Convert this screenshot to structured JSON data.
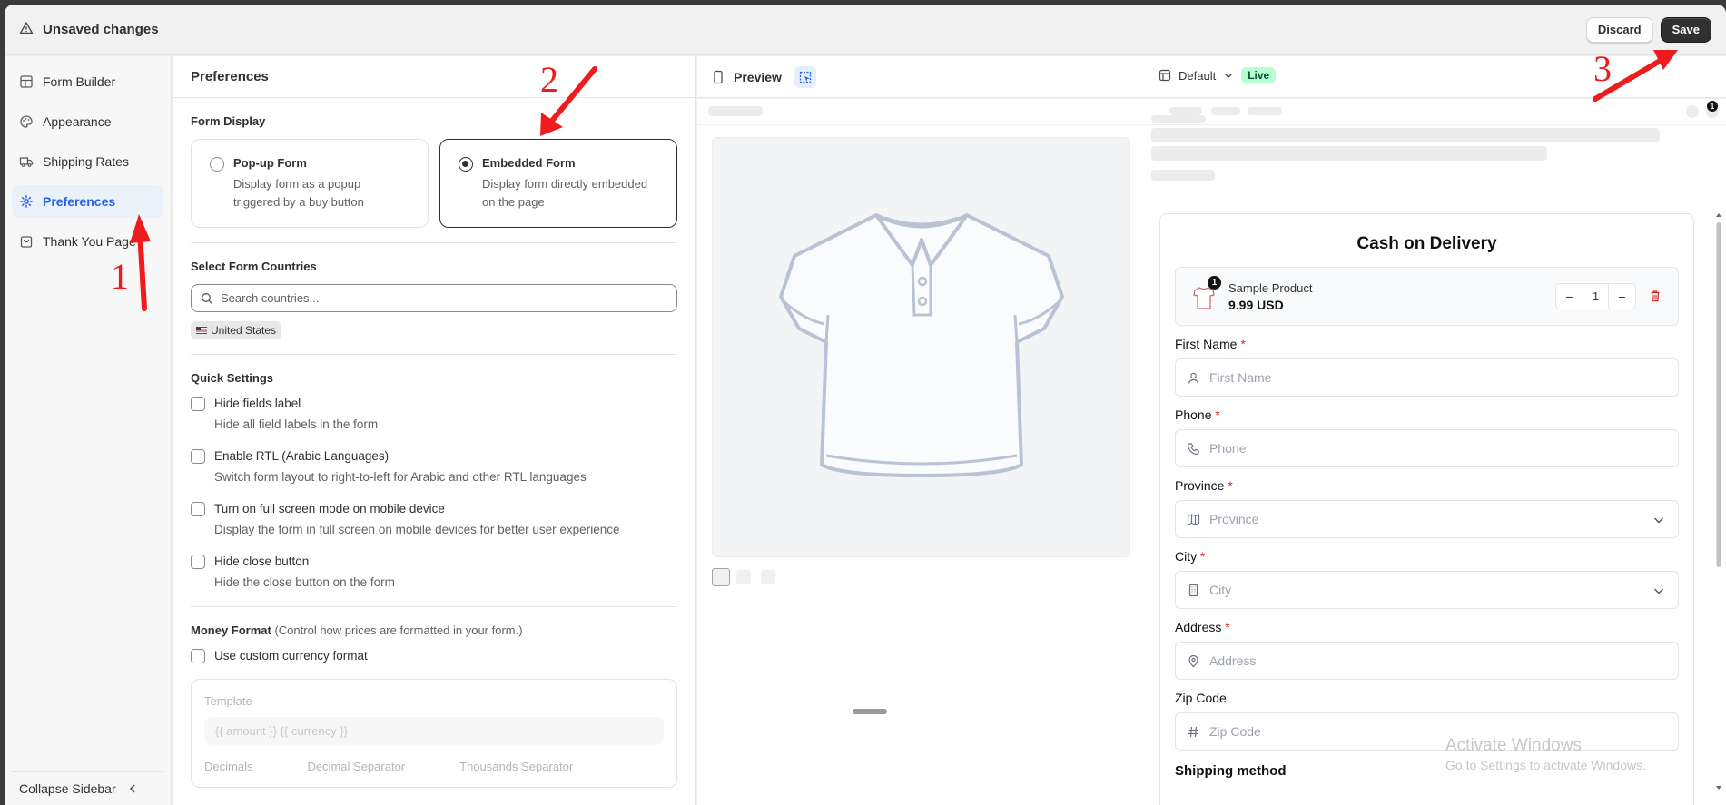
{
  "topbar": {
    "title": "Unsaved changes",
    "discard_label": "Discard",
    "save_label": "Save"
  },
  "sidebar": {
    "items": [
      {
        "label": "Form Builder",
        "icon": "layout-icon",
        "active": false
      },
      {
        "label": "Appearance",
        "icon": "palette-icon",
        "active": false
      },
      {
        "label": "Shipping Rates",
        "icon": "truck-icon",
        "active": false
      },
      {
        "label": "Preferences",
        "icon": "gear-icon",
        "active": true
      },
      {
        "label": "Thank You Page",
        "icon": "bag-icon",
        "active": false
      }
    ],
    "collapse_label": "Collapse Sidebar"
  },
  "preferences": {
    "title": "Preferences",
    "form_display": {
      "title": "Form Display",
      "options": [
        {
          "title": "Pop-up Form",
          "desc": "Display form as a popup triggered by a buy button",
          "selected": false
        },
        {
          "title": "Embedded Form",
          "desc": "Display form directly embedded on the page",
          "selected": true
        }
      ]
    },
    "countries": {
      "title": "Select Form Countries",
      "placeholder": "Search countries...",
      "selected": [
        "United States"
      ]
    },
    "quick_settings": {
      "title": "Quick Settings",
      "items": [
        {
          "label": "Hide fields label",
          "desc": "Hide all field labels in the form",
          "checked": false
        },
        {
          "label": "Enable RTL (Arabic Languages)",
          "desc": "Switch form layout to right-to-left for Arabic and other RTL languages",
          "checked": false
        },
        {
          "label": "Turn on full screen mode on mobile device",
          "desc": "Display the form in full screen on mobile devices for better user experience",
          "checked": false
        },
        {
          "label": "Hide close button",
          "desc": "Hide the close button on the form",
          "checked": false
        }
      ]
    },
    "money_format": {
      "title": "Money Format",
      "hint": "(Control how prices are formatted in your form.)",
      "custom_label": "Use custom currency format",
      "template_label": "Template",
      "template_value": "{{ amount }} {{ currency }}",
      "sub_labels": [
        "Decimals",
        "Decimal Separator",
        "Thousands Separator"
      ]
    }
  },
  "preview": {
    "label": "Preview",
    "theme": "Default",
    "status": "Live",
    "cart_count": "1",
    "form": {
      "title": "Cash on Delivery",
      "product": {
        "name": "Sample Product",
        "price": "9.99 USD",
        "qty": "1",
        "badge": "1"
      },
      "fields": [
        {
          "label": "First Name",
          "required": "*",
          "placeholder": "First Name",
          "icon": "user-icon",
          "select": false
        },
        {
          "label": "Phone",
          "required": "*",
          "placeholder": "Phone",
          "icon": "phone-icon",
          "select": false
        },
        {
          "label": "Province",
          "required": "*",
          "placeholder": "Province",
          "icon": "map-icon",
          "select": true
        },
        {
          "label": "City",
          "required": "*",
          "placeholder": "City",
          "icon": "building-icon",
          "select": true
        },
        {
          "label": "Address",
          "required": "*",
          "placeholder": "Address",
          "icon": "pin-icon",
          "select": false
        },
        {
          "label": "Zip Code",
          "required": "",
          "placeholder": "Zip Code",
          "icon": "hash-icon",
          "select": false
        }
      ],
      "shipping_title": "Shipping method"
    }
  },
  "watermark": {
    "line1": "Activate Windows",
    "line2": "Go to Settings to activate Windows."
  },
  "annotations": [
    "1",
    "2",
    "3"
  ],
  "colors": {
    "accent": "#2563eb",
    "annotation": "#ee1c1c",
    "live_bg": "#b4fed2",
    "required": "#dc2626"
  }
}
